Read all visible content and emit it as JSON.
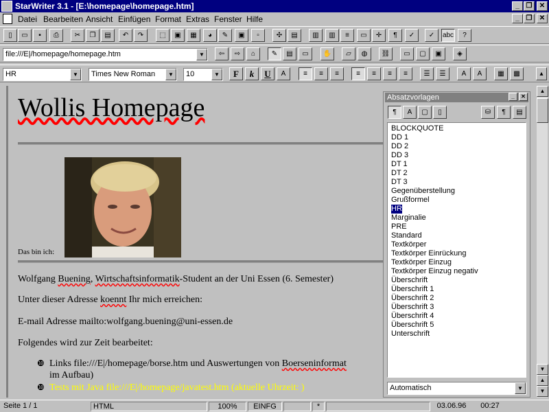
{
  "window": {
    "title": "StarWriter 3.1 - [E:\\homepage\\homepage.htm]",
    "minimize": "_",
    "restore": "❐",
    "close": "✕"
  },
  "menu": {
    "items": [
      "Datei",
      "Bearbeiten",
      "Ansicht",
      "Einfügen",
      "Format",
      "Extras",
      "Fenster",
      "Hilfe"
    ]
  },
  "url_bar": {
    "value": "file:///E|/homepage/homepage.htm"
  },
  "format_bar": {
    "paragraph_style": "HR",
    "font_name": "Times New Roman",
    "font_size": "10",
    "bold": "F",
    "italic": "k",
    "underline": "U"
  },
  "document": {
    "heading": "Wollis Homepage",
    "photo_caption": "Das bin ich:",
    "line1_a": "Wolfgang ",
    "line1_b": "Buening",
    "line1_c": ", ",
    "line1_d": "Wirtschaftsinformatik",
    "line1_e": "-Student an der Uni Essen (6. Semester)",
    "line2_a": "Unter dieser Adresse ",
    "line2_b": "koennt",
    "line2_c": " Ihr mich erreichen:",
    "line3": "E-mail Adresse mailto:wolfgang.buening@uni-essen.de",
    "line4": "Folgendes wird zur Zeit bearbeitet:",
    "bullet_glyph": "❿",
    "list_item1_a": "Links file:///E|/homepage/borse.htm und Auswertungen von ",
    "list_item1_b": "Boerseninformat",
    "list_item1_c": "im Aufbau)",
    "list_item2": "Tests mit Java file:///E|/homepage/javatest.htm (aktuelle Uhrzeit: )"
  },
  "stylist": {
    "title": "Absatzvorlagen",
    "styles": [
      "BLOCKQUOTE",
      "DD 1",
      "DD 2",
      "DD 3",
      "DT 1",
      "DT 2",
      "DT 3",
      "Gegenüberstellung",
      "Grußformel",
      "HR",
      "Marginalie",
      "PRE",
      "Standard",
      "Textkörper",
      "Textkörper Einrückung",
      "Textkörper Einzug",
      "Textkörper Einzug negativ",
      "Überschrift",
      "Überschrift 1",
      "Überschrift 2",
      "Überschrift 3",
      "Überschrift 4",
      "Überschrift 5",
      "Unterschrift"
    ],
    "selected": "HR",
    "filter": "Automatisch"
  },
  "status": {
    "page": "Seite 1 / 1",
    "template": "HTML",
    "zoom": "100%",
    "mode": "EINFG",
    "modified": "*",
    "date": "03.06.96",
    "time": "00:27"
  },
  "colors": {
    "titlebar": "#000080",
    "selection": "#000080",
    "spellcheck": "#ff0000",
    "java_text": "#ffff00"
  }
}
